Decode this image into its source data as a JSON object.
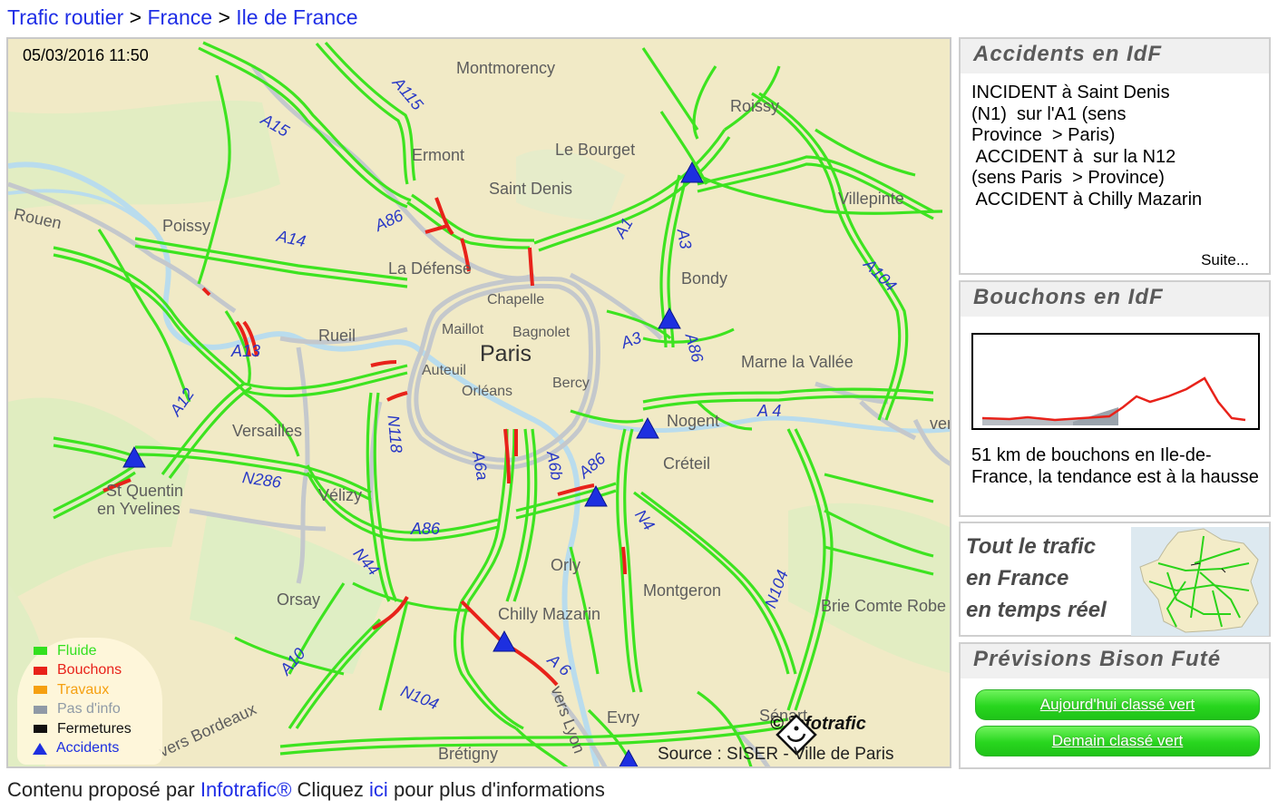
{
  "breadcrumb": {
    "items": [
      "Trafic routier",
      "France",
      "Ile de France"
    ],
    "separator": ">"
  },
  "map": {
    "timestamp": "05/03/2016 11:50",
    "center_label": "Paris",
    "places": {
      "montmorency": "Montmorency",
      "roissy": "Roissy",
      "ermont": "Ermont",
      "le_bourget": "Le Bourget",
      "saint_denis": "Saint Denis",
      "villepinte": "Villepinte",
      "rouen": "Rouen",
      "poissy": "Poissy",
      "la_defense": "La Défense",
      "bondy": "Bondy",
      "chapelle": "Chapelle",
      "maillot": "Maillot",
      "bagnolet": "Bagnolet",
      "rueil": "Rueil",
      "auteuil": "Auteuil",
      "bercy": "Bercy",
      "orleans": "Orléans",
      "marne_la_vallee": "Marne la Vallée",
      "nogent": "Nogent",
      "versailles": "Versailles",
      "creteil": "Créteil",
      "st_quentin_1": "St Quentin",
      "st_quentin_2": "en Yvelines",
      "velizy": "Vélizy",
      "orly": "Orly",
      "montgeron": "Montgeron",
      "brie_comte_robert": "Brie Comte Robe",
      "orsay": "Orsay",
      "chilly_mazarin": "Chilly Mazarin",
      "evry": "Evry",
      "senart": "Sénart",
      "vers_bordeaux": "vers Bordeaux",
      "vers_lyon": "vers Lyon",
      "bretigny": "Brétigny",
      "vers_east": "ver"
    },
    "roads": {
      "a115": "A115",
      "a15": "A15",
      "a86_nw": "A86",
      "a14": "A14",
      "a1": "A1",
      "a3_n": "A3",
      "a104": "A104",
      "a13": "A13",
      "a3_s": "A3",
      "a86_e": "A86",
      "a12": "A12",
      "a4": "A 4",
      "n118": "N118",
      "n286": "N286",
      "a6a": "A6a",
      "a6b": "A6b",
      "a86_se": "A86",
      "a86_s": "A86",
      "n4": "N4",
      "n44": "N44",
      "n104_e": "N104",
      "a10": "A10",
      "n104_s": "N104",
      "a6": "A 6"
    },
    "legend": [
      {
        "label": "Fluide",
        "color": "#33e01f"
      },
      {
        "label": "Bouchons",
        "color": "#e8221a"
      },
      {
        "label": "Travaux",
        "color": "#f5a010"
      },
      {
        "label": "Pas d'info",
        "color": "#8f9aa6"
      },
      {
        "label": "Fermetures",
        "color": "#111111"
      },
      {
        "label": "Accidents",
        "color": "#1d2fe0"
      }
    ],
    "logo_text": "© infotrafic",
    "source": "Source : SISER - Ville de Paris"
  },
  "accidents_panel": {
    "title": "Accidents en IdF",
    "lines": [
      "INCIDENT à Saint Denis",
      "(N1)  sur l'A1 (sens",
      "Province  > Paris)",
      " ACCIDENT à  sur la N12",
      "(sens Paris  > Province)",
      " ACCIDENT à Chilly Mazarin"
    ],
    "more_label": "Suite..."
  },
  "jams_panel": {
    "title": "Bouchons en IdF",
    "summary": "51 km de bouchons en Ile-de-France, la tendance est à la hausse"
  },
  "france_panel": {
    "lines": [
      "Tout le trafic",
      "en France",
      "en temps réel"
    ]
  },
  "bison_panel": {
    "title": "Prévisions Bison Futé",
    "today_label": "Aujourd'hui classé vert",
    "tomorrow_label": "Demain classé vert"
  },
  "footer": {
    "prefix": "Contenu proposé par",
    "brand_link": "Infotrafic®",
    "middle": "Cliquez",
    "here_link": "ici",
    "suffix": "pour plus d'informations"
  },
  "colors": {
    "link": "#1f2ee6",
    "fluide": "#33e01f",
    "bouchon": "#e8221a",
    "pas_info": "#bcc2c8",
    "accident": "#1d2fe0",
    "map_background": "#f1eac6"
  }
}
